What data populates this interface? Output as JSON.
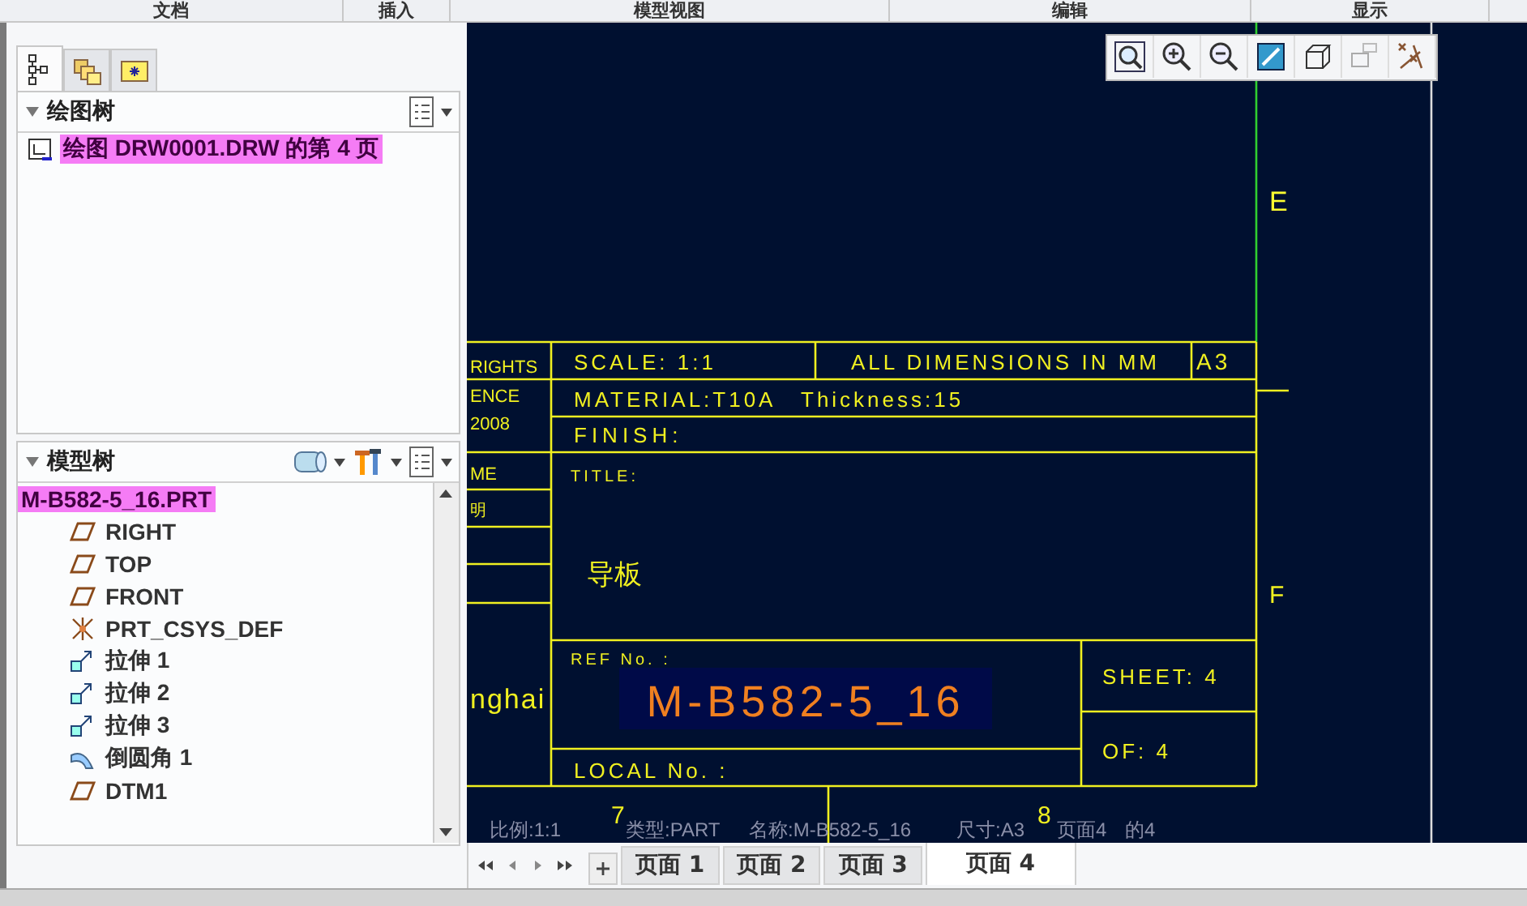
{
  "ribbon_tabs": [
    "文档",
    "插入",
    "模型视图",
    "编辑",
    "显示"
  ],
  "navigator_tabs": [
    {
      "kind": "tree",
      "selected": true
    },
    {
      "kind": "layers",
      "selected": false
    },
    {
      "kind": "favorites",
      "selected": false
    }
  ],
  "drawing_tree": {
    "title": "绘图树",
    "expanded": true,
    "items": [
      {
        "label": "绘图 DRW0001.DRW 的第 4 页",
        "selected": true
      }
    ]
  },
  "model_tree": {
    "title": "模型树",
    "expanded": true,
    "items": [
      {
        "label": "M-B582-5_16.PRT",
        "selected": true,
        "children": [
          {
            "label": "RIGHT",
            "kind": "plane",
            "selected": false
          },
          {
            "label": "TOP",
            "kind": "plane",
            "selected": false
          },
          {
            "label": "FRONT",
            "kind": "plane",
            "selected": false
          },
          {
            "label": "PRT_CSYS_DEF",
            "kind": "csys",
            "selected": false
          },
          {
            "label": "拉伸 1",
            "kind": "extrude",
            "selected": false
          },
          {
            "label": "拉伸 2",
            "kind": "extrude",
            "selected": false
          },
          {
            "label": "拉伸 3",
            "kind": "extrude",
            "selected": false
          },
          {
            "label": "倒圆角 1",
            "kind": "round",
            "selected": false
          },
          {
            "label": "DTM1",
            "kind": "plane",
            "selected": false
          }
        ]
      }
    ]
  },
  "title_block": {
    "side_texts": [
      "RIGHTS",
      "ENCE",
      "2008",
      "ME",
      "明",
      "nghai"
    ],
    "scale": "SCALE:  1:1",
    "dimensions": "ALL DIMENSIONS IN MM",
    "size": "A3",
    "material": "MATERIAL:T10A",
    "thickness": "Thickness:15",
    "finish": "FINISH:",
    "title_label": "TITLE:",
    "title": "导板",
    "ref_label": "REF No. :",
    "ref_no": "M-B582-5_16",
    "local_no": "LOCAL No. :",
    "sheet": "SHEET: 4",
    "of": "OF: 4"
  },
  "zone_labels": {
    "rows": [
      "E",
      "F"
    ],
    "columns": [
      "7",
      "8"
    ]
  },
  "status_line": [
    "比例:1:1",
    "类型:PART",
    "名称:M-B582-5_16",
    "尺寸:A3",
    "页面4",
    "的4"
  ],
  "sheet_tabs": [
    {
      "label": "页面 1",
      "selected": false
    },
    {
      "label": "页面 2",
      "selected": false
    },
    {
      "label": "页面 3",
      "selected": false
    },
    {
      "label": "页面 4",
      "selected": true
    }
  ]
}
